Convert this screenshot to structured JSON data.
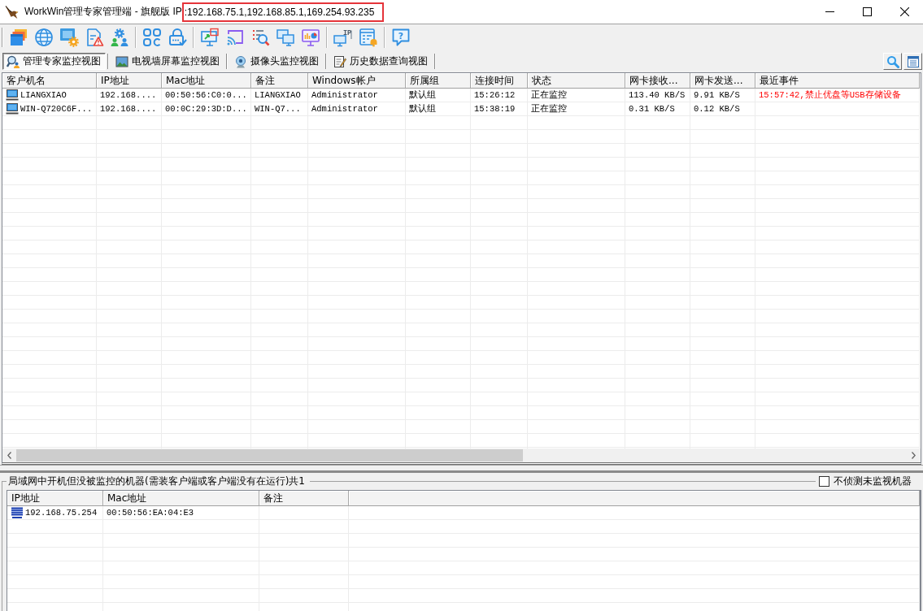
{
  "window": {
    "title": "WorkWin管理专家管理端 - 旗舰版 IP",
    "ip_list": ":192.168.75.1,192.168.85.1,169.254.93.235",
    "ip_highlighted": true
  },
  "toolbar": {
    "ip_icon_label": "IP",
    "help_icon_label": "?"
  },
  "tabs": [
    {
      "label": "管理专家监控视图",
      "selected": true
    },
    {
      "label": "电视墙屏幕监控视图",
      "selected": false
    },
    {
      "label": "摄像头监控视图",
      "selected": false
    },
    {
      "label": "历史数据查询视图",
      "selected": false
    }
  ],
  "clients": {
    "columns": [
      "客户机名",
      "IP地址",
      "Mac地址",
      "备注",
      "Windows帐户",
      "所属组",
      "连接时间",
      "状态",
      "网卡接收...",
      "网卡发送...",
      "最近事件"
    ],
    "rows": [
      {
        "cells": [
          "LIANGXIAO",
          "192.168....",
          "00:50:56:C0:0...",
          "LIANGXIAO",
          "Administrator",
          "默认组",
          "15:26:12",
          "正在监控",
          "113.40 KB/S",
          "9.91 KB/S",
          "15:57:42,禁止优盘等USB存储设备"
        ]
      },
      {
        "cells": [
          "WIN-Q720C6F...",
          "192.168....",
          "00:0C:29:3D:D...",
          "WIN-Q7...",
          "Administrator",
          "默认组",
          "15:38:19",
          "正在监控",
          "0.31 KB/S",
          "0.12 KB/S"
        ]
      }
    ]
  },
  "unmonitored": {
    "title": "局域网中开机但没被监控的机器(需装客户端或客户端没有在运行)共1",
    "option": {
      "label": "不侦测未监视机器",
      "checked": false
    },
    "columns": [
      "IP地址",
      "Mac地址",
      "备注"
    ],
    "rows": [
      {
        "cells": [
          "192.168.75.254",
          "00:50:56:EA:04:E3"
        ]
      }
    ]
  }
}
